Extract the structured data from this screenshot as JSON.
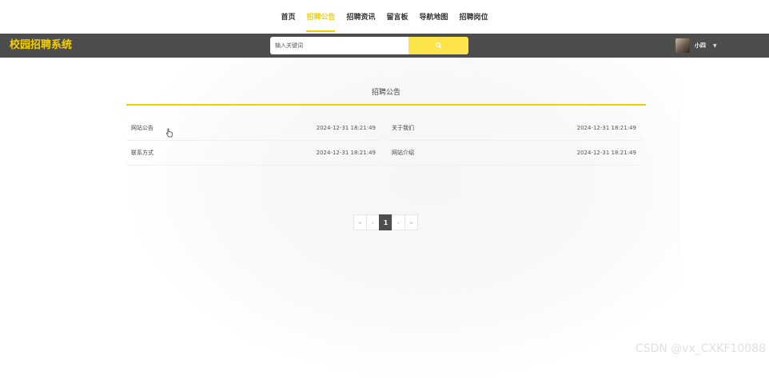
{
  "nav": {
    "items": [
      {
        "label": "首页",
        "active": false
      },
      {
        "label": "招聘公告",
        "active": true
      },
      {
        "label": "招聘资讯",
        "active": false
      },
      {
        "label": "留言板",
        "active": false
      },
      {
        "label": "导航地图",
        "active": false
      },
      {
        "label": "招聘岗位",
        "active": false
      }
    ]
  },
  "header": {
    "brand": "校园招聘系统",
    "search_placeholder": "输入关键词",
    "user_name": "小四"
  },
  "main": {
    "section_title": "招聘公告",
    "rows": [
      {
        "title": "网站公告",
        "date": "2024-12-31 18:21:49"
      },
      {
        "title": "关于我们",
        "date": "2024-12-31 18:21:49"
      },
      {
        "title": "联系方式",
        "date": "2024-12-31 18:21:49"
      },
      {
        "title": "网站介绍",
        "date": "2024-12-31 18:21:49"
      }
    ]
  },
  "pagination": {
    "first": "«",
    "prev": "‹",
    "current": "1",
    "next": "›",
    "last": "»"
  },
  "watermark": "CSDN @vx_CXKF10088",
  "colors": {
    "accent": "#f5d000",
    "header_bg": "#4d4d4d",
    "search_button": "#fce44a"
  }
}
